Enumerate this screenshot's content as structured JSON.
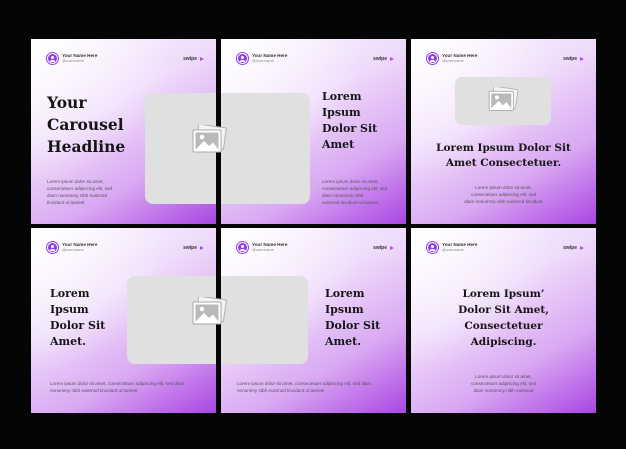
{
  "profile": {
    "name": "Your Name Here",
    "username": "@username"
  },
  "swipe_label": "swipe",
  "body_text": {
    "three_lines": [
      "Lorem ipsum dolor sit amet,",
      "consectetuer adipiscing elit, sed",
      "diam nonummy nibh euismod"
    ],
    "four_lines_a": [
      "Lorem ipsum dolor sit amet,",
      "consectetuer adipiscing elit, sed",
      "diam nonummy nibh euismod",
      "tincidunt ut laoreet"
    ],
    "four_lines_b": [
      "Lorem ipsum dolor sit amet,",
      "consectetuer adipiscing elit, sed",
      "diam nonummy nibh",
      "euismod tincidunt ut laoreet"
    ],
    "centered": [
      "Lorem ipsum dolor sit amet,",
      "consectetuer adipiscing elit, sed",
      "diam nonummy nibh euismod tincidunt"
    ],
    "two_lines": [
      "Lorem ipsum dolor sit amet, consectetuer adipiscing elit, sed diam",
      "nonummy nibh euismod tincidunt ut laoreet"
    ]
  },
  "cards": [
    {
      "headline": [
        "Your",
        "Carousel",
        "Headline"
      ]
    },
    {
      "headline": [
        "Lorem",
        "Ipsum",
        "Dolor Sit",
        "Amet"
      ]
    },
    {
      "headline": [
        "Lorem Ipsum Dolor Sit",
        "Amet Consectetuer."
      ]
    },
    {
      "headline": [
        "Lorem",
        "Ipsum",
        "Dolor Sit",
        "Amet."
      ]
    },
    {
      "headline": [
        "Lorem",
        "Ipsum",
        "Dolor Sit",
        "Amet."
      ]
    },
    {
      "headline": [
        "Lorem Ipsum’",
        "Dolor Sit Amet,",
        "Consectetuer",
        "Adipiscing."
      ]
    }
  ],
  "icons": {
    "profile": "user-avatar-icon",
    "swipe": "arrow-right-icon",
    "image": "image-placeholder-icon"
  },
  "colors": {
    "accent": "#a945e3",
    "background": "#050505",
    "photo_placeholder": "#e0e0e0"
  }
}
